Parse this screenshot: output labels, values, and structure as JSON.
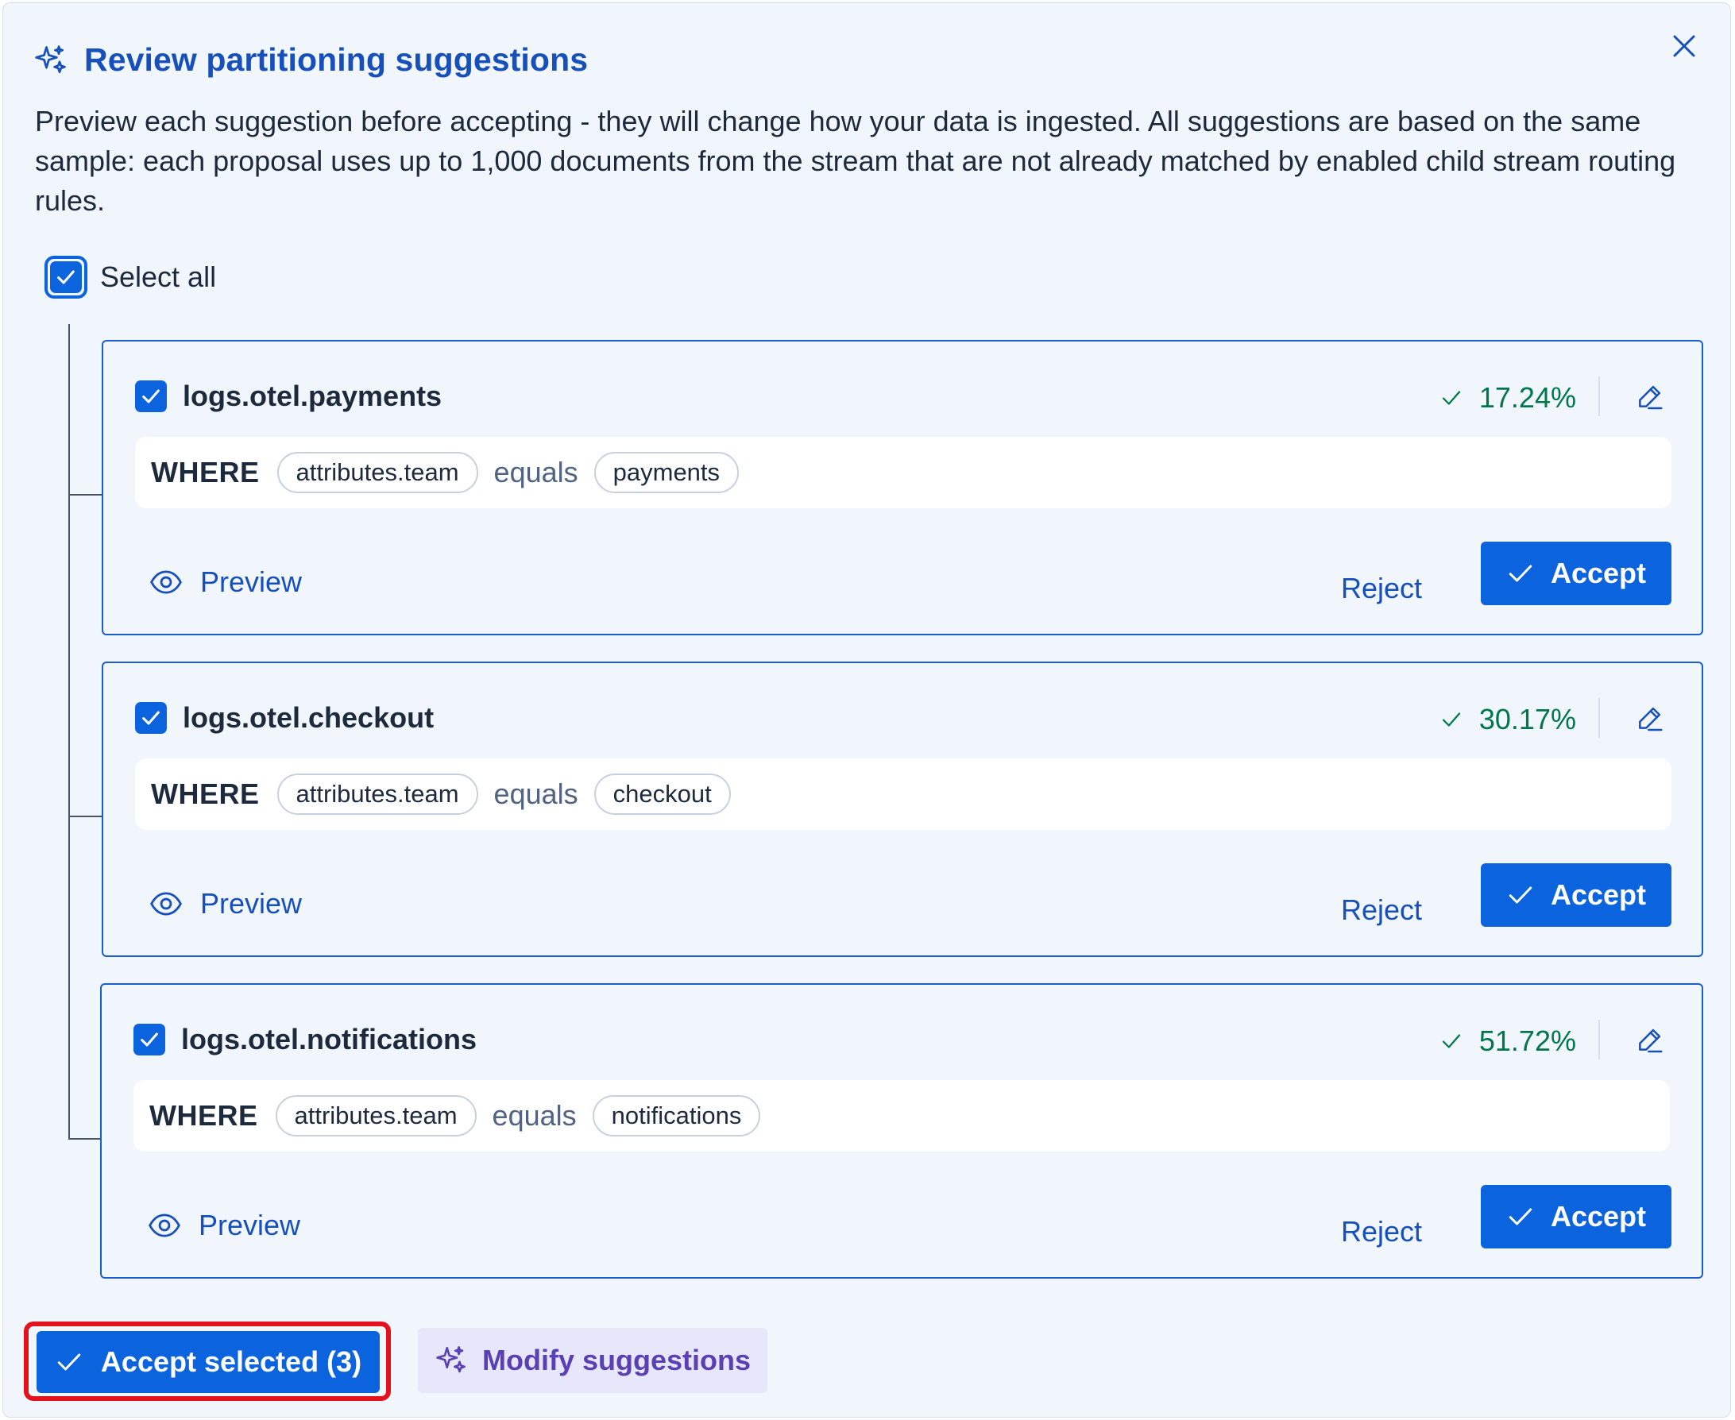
{
  "header": {
    "title": "Review partitioning suggestions",
    "description": "Preview each suggestion before accepting - they will change how your data is ingested. All suggestions are based on the same sample: each proposal uses up to 1,000 documents from the stream that are not already matched by enabled child stream routing rules."
  },
  "select_all": {
    "label": "Select all",
    "checked": true
  },
  "suggestions": [
    {
      "name": "logs.otel.payments",
      "percentage": "17.24%",
      "keyword": "WHERE",
      "field": "attributes.team",
      "operator": "equals",
      "value": "payments",
      "preview_label": "Preview",
      "reject_label": "Reject",
      "accept_label": "Accept",
      "checked": true
    },
    {
      "name": "logs.otel.checkout",
      "percentage": "30.17%",
      "keyword": "WHERE",
      "field": "attributes.team",
      "operator": "equals",
      "value": "checkout",
      "preview_label": "Preview",
      "reject_label": "Reject",
      "accept_label": "Accept",
      "checked": true
    },
    {
      "name": "logs.otel.notifications",
      "percentage": "51.72%",
      "keyword": "WHERE",
      "field": "attributes.team",
      "operator": "equals",
      "value": "notifications",
      "preview_label": "Preview",
      "reject_label": "Reject",
      "accept_label": "Accept",
      "checked": true
    }
  ],
  "footer": {
    "accept_selected_label": "Accept selected (3)",
    "modify_label": "Modify suggestions"
  },
  "colors": {
    "primary": "#0b64dd",
    "title": "#1750ba",
    "success": "#00774a",
    "highlight": "#e3121c",
    "ai_accent": "#5b40b3"
  },
  "icons": {
    "title": "sparkles-icon",
    "close": "close-icon",
    "check": "check-icon",
    "edit": "pencil-icon",
    "preview": "eye-icon",
    "modify": "sparkles-icon"
  }
}
